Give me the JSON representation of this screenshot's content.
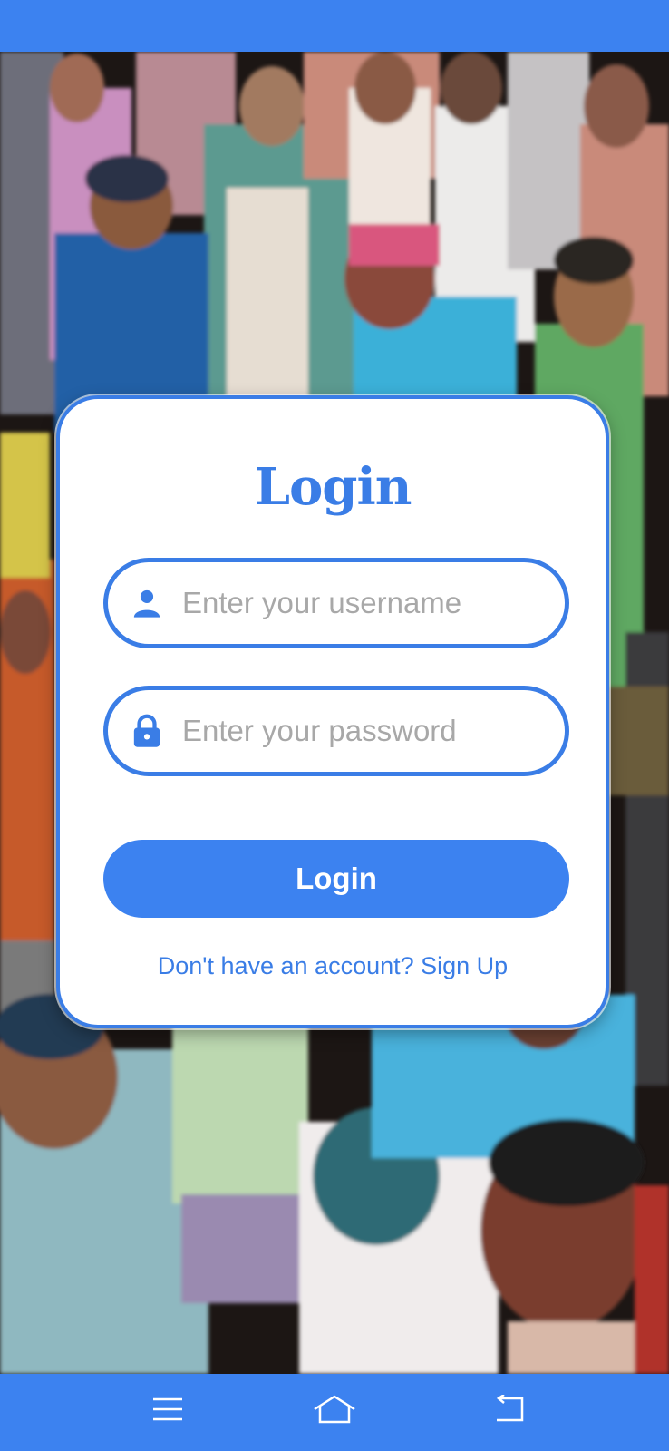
{
  "colors": {
    "accent": "#3c82f0",
    "card_border": "#3a7de6",
    "placeholder": "#a8a8a8",
    "card_background": "#ffffff"
  },
  "login_card": {
    "title": "Login",
    "username": {
      "icon": "person-icon",
      "value": "",
      "placeholder": "Enter your username"
    },
    "password": {
      "icon": "lock-icon",
      "value": "",
      "placeholder": "Enter your password"
    },
    "submit_label": "Login",
    "signup_prompt": "Don't have an account? Sign Up"
  },
  "background": {
    "description_icon": "crowd-painting-image"
  },
  "nav_bar": {
    "items": [
      {
        "icon": "menu-icon"
      },
      {
        "icon": "home-icon"
      },
      {
        "icon": "back-icon"
      }
    ]
  }
}
